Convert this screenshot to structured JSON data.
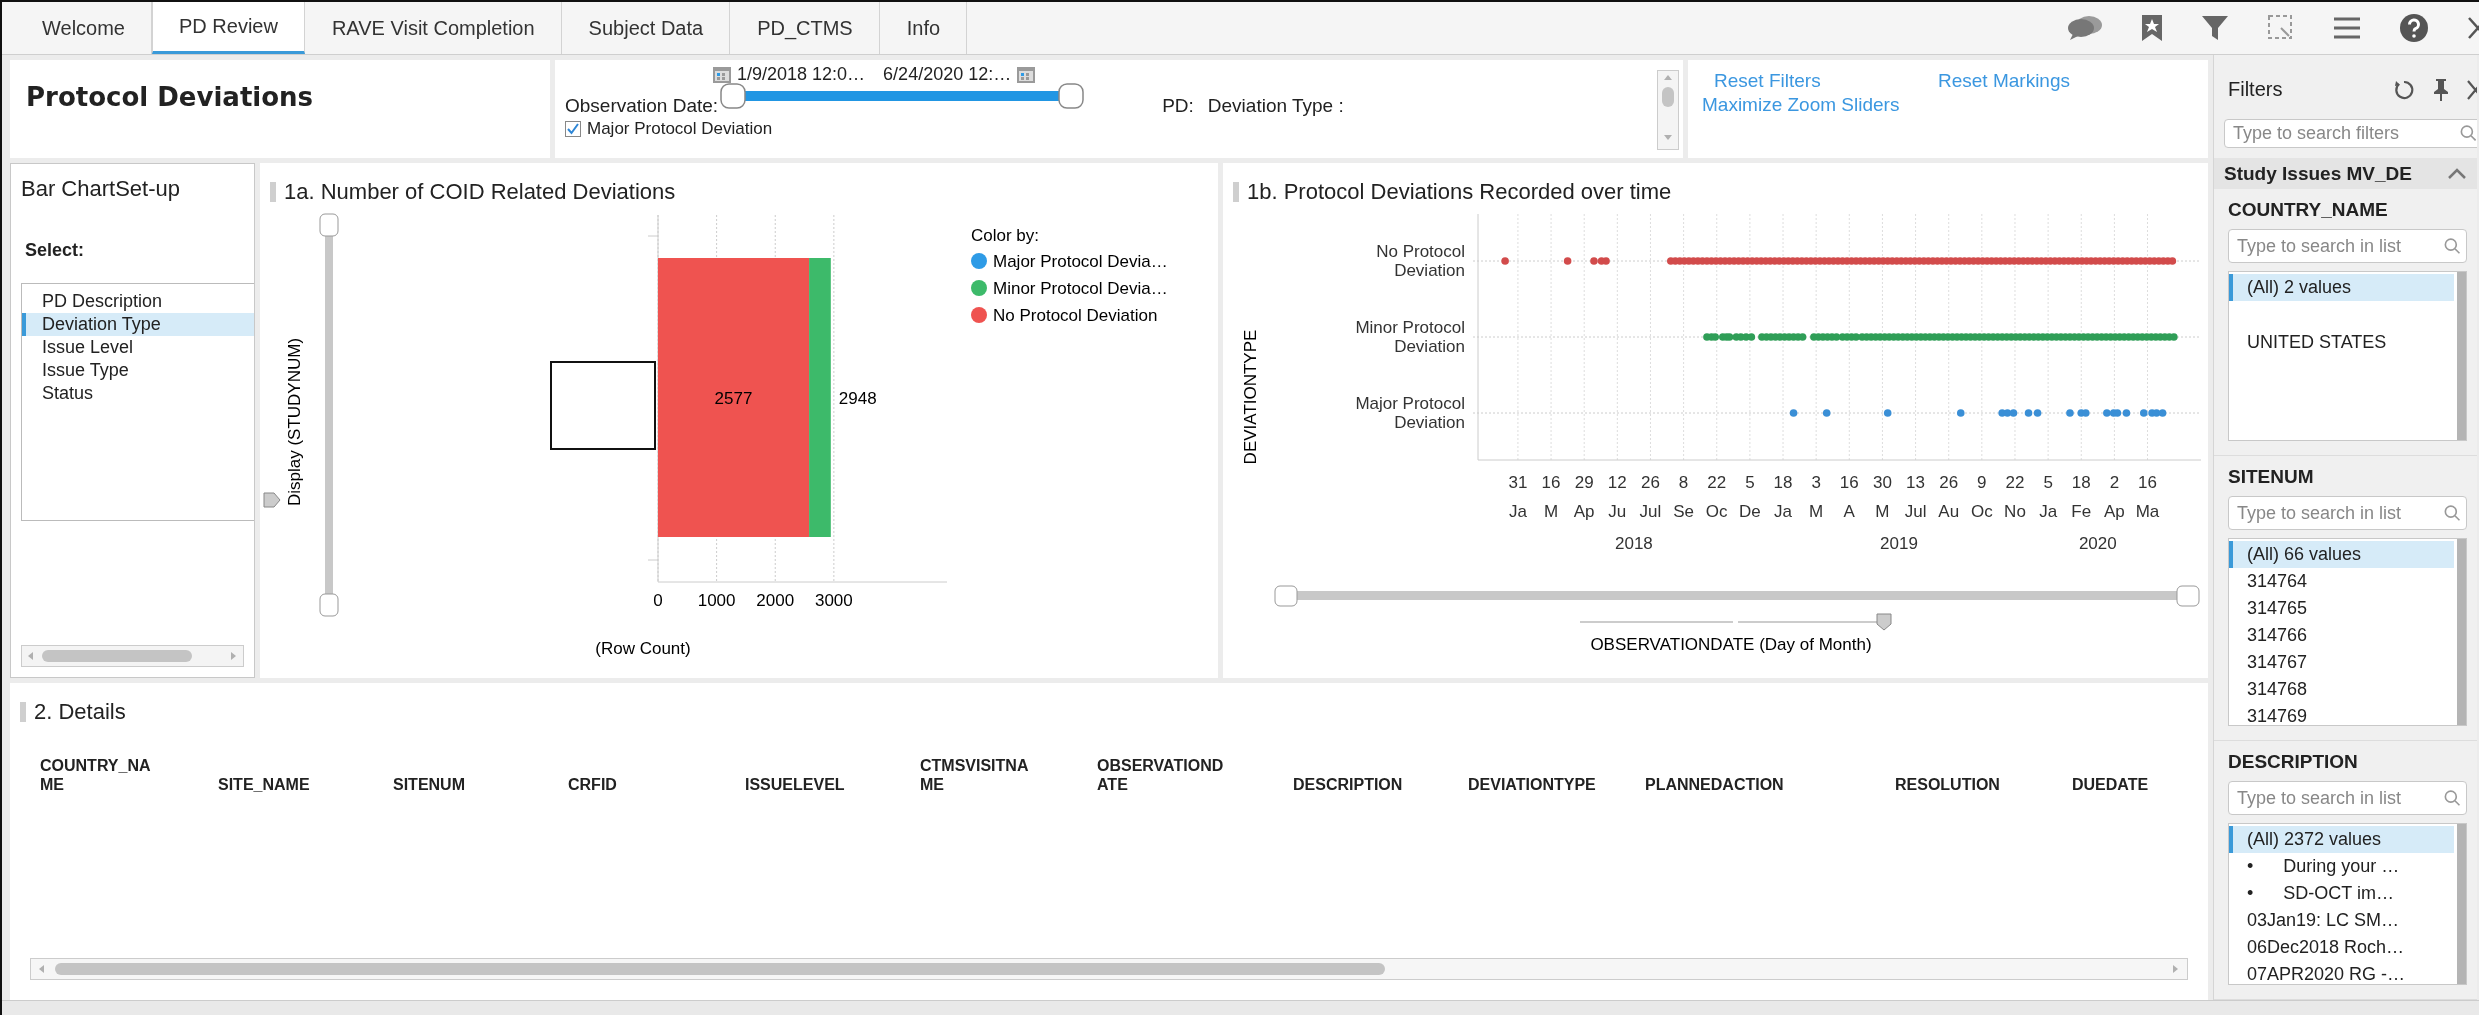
{
  "tabs": [
    {
      "label": "Welcome",
      "selected": false
    },
    {
      "label": "PD Review",
      "selected": true
    },
    {
      "label": "RAVE Visit Completion",
      "selected": false
    },
    {
      "label": "Subject Data",
      "selected": false
    },
    {
      "label": "PD_CTMS",
      "selected": false
    },
    {
      "label": "Info",
      "selected": false
    }
  ],
  "header": {
    "title": "Protocol Deviations"
  },
  "date_filter": {
    "label": "Observation Date:",
    "start": "1/9/2018 12:0…",
    "end": "6/24/2020 12:…",
    "checkbox": {
      "label": "Major Protocol Deviation",
      "checked": true
    },
    "slider": {
      "handles": [
        {
          "level": 0
        },
        {
          "level": 1
        }
      ]
    }
  },
  "pd_filter": {
    "prefix": "PD:",
    "label": "Deviation Type :"
  },
  "links": [
    "Reset Filters",
    "Reset Markings",
    "Maximize Zoom Sliders"
  ],
  "setup": {
    "title": "Bar ChartSet-up",
    "select_label": "Select:",
    "items": [
      {
        "label": "PD Description",
        "selected": false
      },
      {
        "label": "Deviation Type",
        "selected": true
      },
      {
        "label": "Issue Level",
        "selected": false
      },
      {
        "label": "Issue Type",
        "selected": false
      },
      {
        "label": "Status",
        "selected": false
      }
    ]
  },
  "chart_1a": {
    "title": "1a. Number of COID Related Deviations",
    "slider_label": "Display (STUDYNUM)",
    "zoom_slider": {
      "handles": [
        {
          "level": 0
        },
        {
          "level": 1
        }
      ]
    },
    "chart_data": {
      "type": "bar",
      "orientation": "horizontal",
      "stacked": true,
      "grid": true,
      "legend": {
        "title": "Color by:"
      },
      "xlabel": "(Row Count)",
      "xlim": [
        0,
        4930
      ],
      "xticks": [
        0,
        1000,
        2000,
        3000
      ],
      "series": [
        {
          "name": "No Protocol Deviation",
          "color": "#ef5350",
          "values": [
            2577
          ],
          "value_labels": [
            "2577"
          ]
        },
        {
          "name": "Minor Protocol Devia…",
          "color": "#3dba6a",
          "values": [
            371
          ],
          "value_labels": [
            null
          ]
        },
        {
          "name": "Major Protocol Devia…",
          "color": "#2e9be6",
          "values": [
            0
          ],
          "value_labels": [
            null
          ]
        }
      ],
      "annotations": [
        {
          "x": 2948,
          "text": "2948"
        }
      ]
    }
  },
  "chart_1b": {
    "title": "1b. Protocol Deviations Recorded over time",
    "kind": "picture",
    "ylabel": "DEVIATIONTYPE",
    "xlabel": "OBSERVATIONDATE (Day of Month)",
    "row_labels": [
      "No Protocol Deviation",
      "Minor Protocol Deviation",
      "Major Protocol Deviation"
    ],
    "day_labels": [
      "31",
      "16",
      "29",
      "12",
      "26",
      "8",
      "22",
      "5",
      "18",
      "3",
      "16",
      "30",
      "13",
      "26",
      "9",
      "22",
      "5",
      "18",
      "2",
      "16"
    ],
    "month_labels": [
      "Ja",
      "M",
      "Ap",
      "Ju",
      "Jul",
      "Se",
      "Oc",
      "De",
      "Ja",
      "M",
      "A",
      "M",
      "Jul",
      "Au",
      "Oc",
      "No",
      "Ja",
      "Fe",
      "Ap",
      "Ma"
    ],
    "year_labels": [
      "2018",
      "2019",
      "2020"
    ],
    "zoom_slider": {
      "handles": [
        {
          "level": 0
        },
        {
          "level": 1
        }
      ]
    },
    "axis_selector": {
      "level": 1
    }
  },
  "details": {
    "title": "2. Details",
    "columns": [
      "COUNTRY_NAME",
      "SITE_NAME",
      "SITENUM",
      "CRFID",
      "ISSUELEVEL",
      "CTMSVISITNAME",
      "OBSERVATIONDATE",
      "DESCRIPTION",
      "DEVIATIONTYPE",
      "PLANNEDACTION",
      "RESOLUTION",
      "DUEDATE"
    ]
  },
  "filters": {
    "title": "Filters",
    "search": {
      "placeholder": "Type to search filters"
    },
    "group": {
      "title": "Study Issues MV_DE",
      "expanded": true
    },
    "sections": [
      {
        "title": "COUNTRY_NAME",
        "placeholder": "Type to search in list",
        "items": [
          {
            "label": "(All) 2 values",
            "selected": true
          },
          {
            "label": "UNITED STATES",
            "selected": false
          }
        ]
      },
      {
        "title": "SITENUM",
        "placeholder": "Type to search in list",
        "items": [
          {
            "label": "(All) 66 values",
            "selected": true
          },
          {
            "label": "314764",
            "selected": false
          },
          {
            "label": "314765",
            "selected": false
          },
          {
            "label": "314766",
            "selected": false
          },
          {
            "label": "314767",
            "selected": false
          },
          {
            "label": "314768",
            "selected": false
          },
          {
            "label": "314769",
            "selected": false
          }
        ]
      },
      {
        "title": "DESCRIPTION",
        "placeholder": "Type to search in list",
        "items": [
          {
            "label": "(All) 2372 values",
            "selected": true
          },
          {
            "label": "•      During your …",
            "selected": false
          },
          {
            "label": "•      SD-OCT im…",
            "selected": false
          },
          {
            "label": "03Jan19: LC SM…",
            "selected": false
          },
          {
            "label": "06Dec2018 Roch…",
            "selected": false
          },
          {
            "label": "07APR2020 RG -…",
            "selected": false
          }
        ]
      }
    ]
  }
}
